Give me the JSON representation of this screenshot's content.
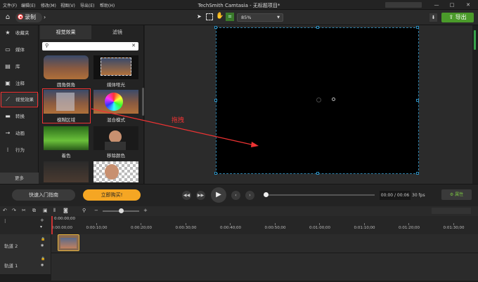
{
  "menu": [
    "文件(F)",
    "编辑(E)",
    "修改(M)",
    "视图(V)",
    "导出(E)",
    "帮助(H)"
  ],
  "app_title": "TechSmith Camtasia - 无标题项目*",
  "window_controls": {
    "minimize": "—",
    "maximize": "□",
    "close": "✕"
  },
  "toolbar": {
    "record_label": "录制",
    "zoom_value": "85%",
    "export_label": "导出"
  },
  "sidebar": {
    "items": [
      {
        "label": "收藏夹",
        "icon": "star-icon"
      },
      {
        "label": "媒体",
        "icon": "film-icon"
      },
      {
        "label": "库",
        "icon": "library-icon"
      },
      {
        "label": "注释",
        "icon": "annotation-icon"
      },
      {
        "label": "视觉效果",
        "icon": "magic-wand-icon"
      },
      {
        "label": "转换",
        "icon": "transition-icon"
      },
      {
        "label": "动画",
        "icon": "animation-icon"
      },
      {
        "label": "行为",
        "icon": "behavior-icon"
      }
    ],
    "more_label": "更多"
  },
  "panel": {
    "tabs": [
      "视觉效果",
      "滤镜"
    ],
    "search_placeholder": "",
    "effects": [
      {
        "label": "圆角倒角"
      },
      {
        "label": "媒体哑光"
      },
      {
        "label": "模糊区域"
      },
      {
        "label": "混合模式"
      },
      {
        "label": "着色"
      },
      {
        "label": "移除颜色"
      },
      {
        "label": ""
      },
      {
        "label": ""
      }
    ]
  },
  "annotation": {
    "drag_label": "拖拽",
    "color": "#e33333"
  },
  "playback": {
    "guide_label": "快速入门指南",
    "buy_label": "立即购买!",
    "timecode": "00:00 / 00:06",
    "fps": "30 fps",
    "properties_label": "属性"
  },
  "timeline": {
    "playhead_time": "0:00:00;00",
    "ticks": [
      "0:00:00;00",
      "0:00:10;00",
      "0:00:20;00",
      "0:00:30;00",
      "0:00:40;00",
      "0:00:50;00",
      "0:01:00;00",
      "0:01:10;00",
      "0:01:20;00",
      "0:01:30;00"
    ],
    "tracks": [
      {
        "name": "轨道 2"
      },
      {
        "name": "轨道 1"
      }
    ]
  },
  "colors": {
    "accent_green": "#4a9a2a",
    "buy_orange": "#f5a623",
    "highlight_red": "#e33333"
  }
}
